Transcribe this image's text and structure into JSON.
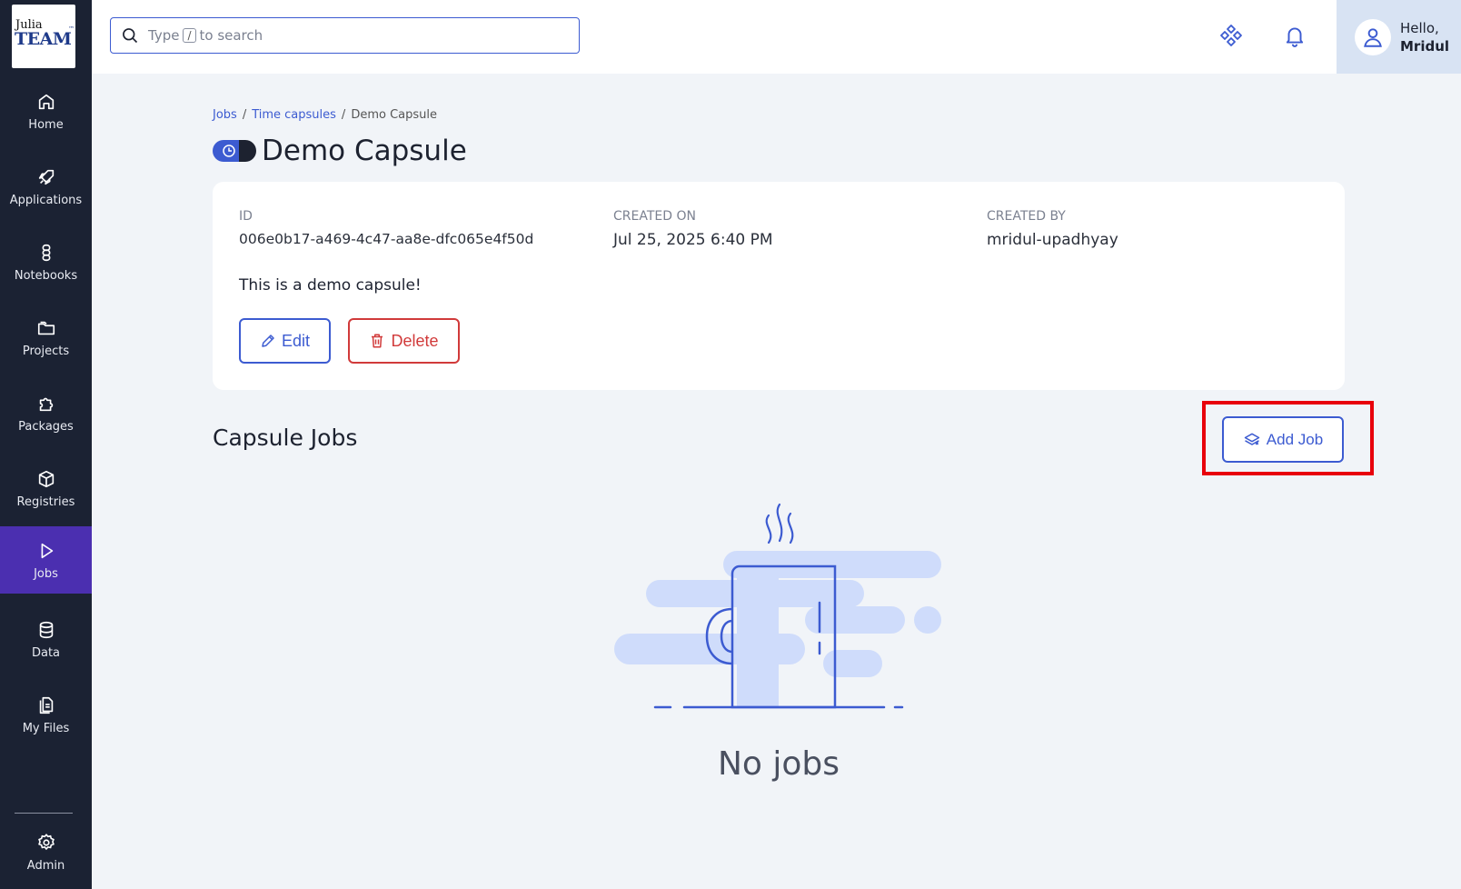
{
  "logo": {
    "line1": "Julia",
    "line2": "TEAM",
    "mark": "™"
  },
  "sidebar": {
    "items": [
      {
        "label": "Home",
        "icon": "home-icon"
      },
      {
        "label": "Applications",
        "icon": "rocket-icon"
      },
      {
        "label": "Notebooks",
        "icon": "notebook-icon"
      },
      {
        "label": "Projects",
        "icon": "folder-icon"
      },
      {
        "label": "Packages",
        "icon": "puzzle-icon"
      },
      {
        "label": "Registries",
        "icon": "cube-icon"
      },
      {
        "label": "Jobs",
        "icon": "play-icon",
        "active": true
      },
      {
        "label": "Data",
        "icon": "database-icon"
      },
      {
        "label": "My Files",
        "icon": "files-icon"
      }
    ],
    "admin": {
      "label": "Admin",
      "icon": "gear-icon"
    }
  },
  "header": {
    "search": {
      "prefix": "Type",
      "key": "/",
      "suffix": "to search"
    },
    "user": {
      "greeting": "Hello,",
      "name": "Mridul"
    }
  },
  "breadcrumb": {
    "jobs": "Jobs",
    "capsules": "Time capsules",
    "current": "Demo Capsule",
    "sep": "/"
  },
  "capsule": {
    "title": "Demo Capsule",
    "id_label": "ID",
    "id_value": "006e0b17-a469-4c47-aa8e-dfc065e4f50d",
    "created_on_label": "CREATED ON",
    "created_on_value": "Jul 25, 2025 6:40 PM",
    "created_by_label": "CREATED BY",
    "created_by_value": "mridul-upadhyay",
    "description": "This is a demo capsule!",
    "edit_label": "Edit",
    "delete_label": "Delete"
  },
  "jobs_section": {
    "title": "Capsule Jobs",
    "add_label": "Add Job",
    "empty_text": "No jobs"
  },
  "colors": {
    "accent": "#3c5bd1",
    "danger": "#d13a3a",
    "sidebar": "#1b2233",
    "active": "#4b2fb0",
    "highlight": "#e8000b"
  }
}
